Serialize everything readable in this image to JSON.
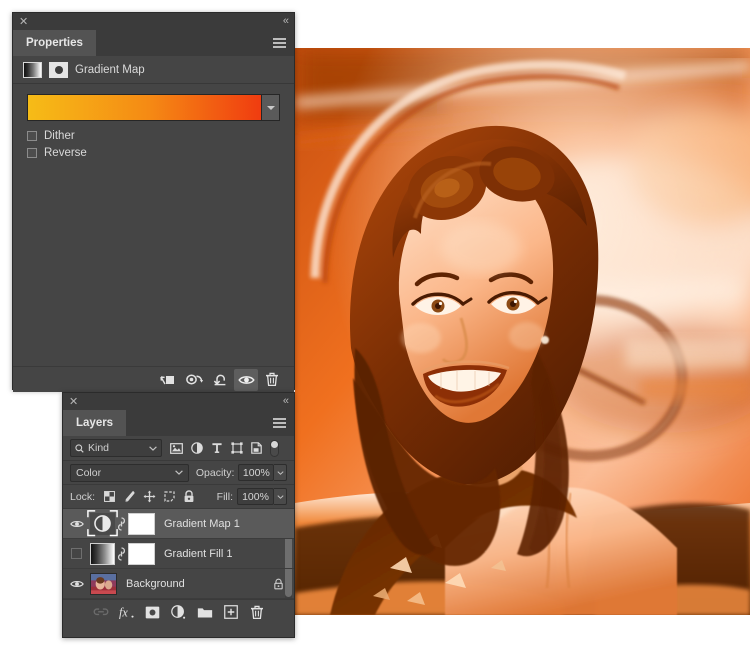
{
  "properties_panel": {
    "tab_label": "Properties",
    "close_icon": "close-icon",
    "collapse_icon": "collapse-panel-icon",
    "menu_icon": "panel-menu-icon",
    "adjustment_type": "Gradient Map",
    "adjustment_thumb_icon": "gradient-map-thumbnail-icon",
    "mask_thumb_icon": "layer-mask-thumbnail-icon",
    "gradient": {
      "start_color": "#F6BC17",
      "mid_color": "#F58A14",
      "end_color": "#F03C10",
      "dropdown_icon": "gradient-preset-chevron-icon"
    },
    "options": [
      {
        "label": "Dither",
        "checked": false
      },
      {
        "label": "Reverse",
        "checked": false
      }
    ],
    "footer_buttons": [
      {
        "name": "clip-to-layer-button",
        "active": false
      },
      {
        "name": "view-previous-state-button",
        "active": false
      },
      {
        "name": "reset-adjustment-button",
        "active": false
      },
      {
        "name": "toggle-layer-visibility-button",
        "active": true
      },
      {
        "name": "delete-adjustment-layer-button",
        "active": false
      }
    ]
  },
  "layers_panel": {
    "tab_label": "Layers",
    "close_icon": "close-icon",
    "collapse_icon": "collapse-panel-icon",
    "menu_icon": "panel-menu-icon",
    "filter": {
      "search_icon": "search-icon",
      "kind_label": "Kind",
      "chevron_icon": "chevron-down-icon",
      "type_filters": [
        "filter-pixel-layers-icon",
        "filter-adjustment-layers-icon",
        "filter-type-layers-icon",
        "filter-shape-layers-icon",
        "filter-smart-object-layers-icon"
      ],
      "toggle_name": "filter-enable-toggle"
    },
    "blend": {
      "mode": "Color",
      "mode_chevron_icon": "chevron-down-icon",
      "opacity_label": "Opacity:",
      "opacity_value": "100%",
      "opacity_chevron_icon": "chevron-down-icon"
    },
    "lock": {
      "label": "Lock:",
      "icons": [
        "lock-transparent-pixels-icon",
        "lock-image-pixels-icon",
        "lock-position-icon",
        "lock-artboard-nesting-icon",
        "lock-all-icon"
      ],
      "fill_label": "Fill:",
      "fill_value": "100%",
      "fill_chevron_icon": "chevron-down-icon"
    },
    "layers": [
      {
        "name": "Gradient Map 1",
        "visible": true,
        "selected": true,
        "thumb_icon": "adjustment-layer-thumbnail-icon",
        "link_icon": "link-mask-icon",
        "has_mask": true,
        "locked": false
      },
      {
        "name": "Gradient Fill 1",
        "visible": false,
        "selected": false,
        "thumb_icon": "gradient-fill-thumbnail-icon",
        "link_icon": "link-mask-icon",
        "has_mask": true,
        "locked": false
      },
      {
        "name": "Background",
        "visible": true,
        "selected": false,
        "thumb_icon": "photo-thumbnail-icon",
        "link_icon": null,
        "has_mask": false,
        "locked": true
      }
    ],
    "footer_buttons": [
      {
        "name": "link-layers-button",
        "disabled": true
      },
      {
        "name": "add-layer-style-button",
        "disabled": false
      },
      {
        "name": "add-layer-mask-button",
        "disabled": false
      },
      {
        "name": "new-adjustment-layer-button",
        "disabled": false
      },
      {
        "name": "new-group-button",
        "disabled": false
      },
      {
        "name": "new-layer-button",
        "disabled": false
      },
      {
        "name": "delete-layer-button",
        "disabled": false
      }
    ]
  },
  "canvas": {
    "image_description": "Smiling woman leaning on car door, orange gradient map applied",
    "tint_highlight": "#fde8d8",
    "tint_mid": "#f0661f",
    "tint_shadow": "#7a3a06"
  }
}
